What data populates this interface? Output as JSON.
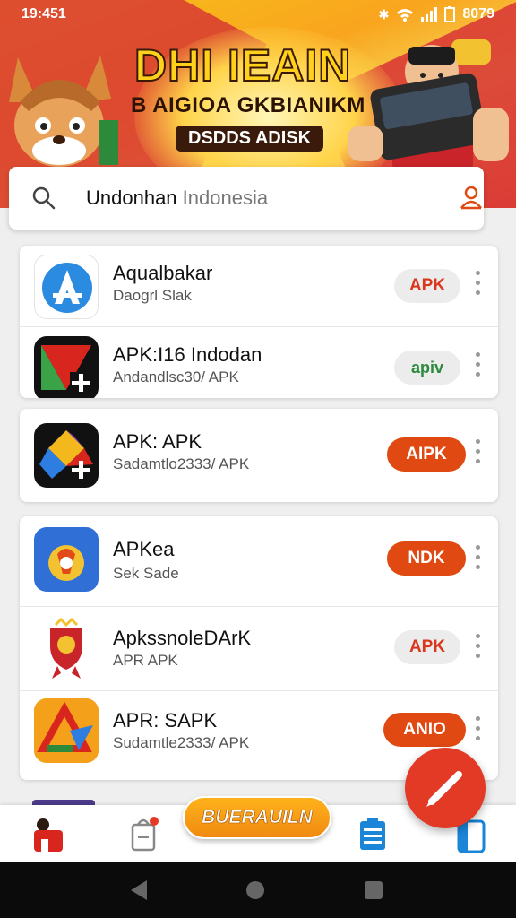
{
  "status_bar": {
    "time": "19:451",
    "battery": "8079"
  },
  "banner": {
    "title_main": "DHI IEAIN",
    "title_sub": "B AIGIOA GKBIANIKM",
    "title_tag": "DSDDS ADISK"
  },
  "search": {
    "text_main": "Undonhan",
    "text_rest": " Indonesia"
  },
  "apps": [
    {
      "name": "Aqualbakar",
      "subtitle": "Daogrl Slak",
      "button": "APK"
    },
    {
      "name": "APK:I16 Indodan",
      "subtitle": "Andandlsc30/ APK",
      "button": "apiv"
    },
    {
      "name": "APK: APK",
      "subtitle": "Sadamtlo2333/ APK",
      "button": "AIPK"
    },
    {
      "name": "APKea",
      "subtitle": "Sek Sade",
      "button": "NDK"
    },
    {
      "name": "ApkssnoleDArK",
      "subtitle": "APR APK",
      "button": "APK"
    },
    {
      "name": "APR: SAPK",
      "subtitle": "Sudamtle2333/ APK",
      "button": "ANIO"
    }
  ],
  "bottom_nav": {
    "promo_label": "BUERAUILN"
  },
  "colors": {
    "accent": "#e04a12",
    "fab": "#e33a26",
    "promo": "#f5a01a"
  }
}
